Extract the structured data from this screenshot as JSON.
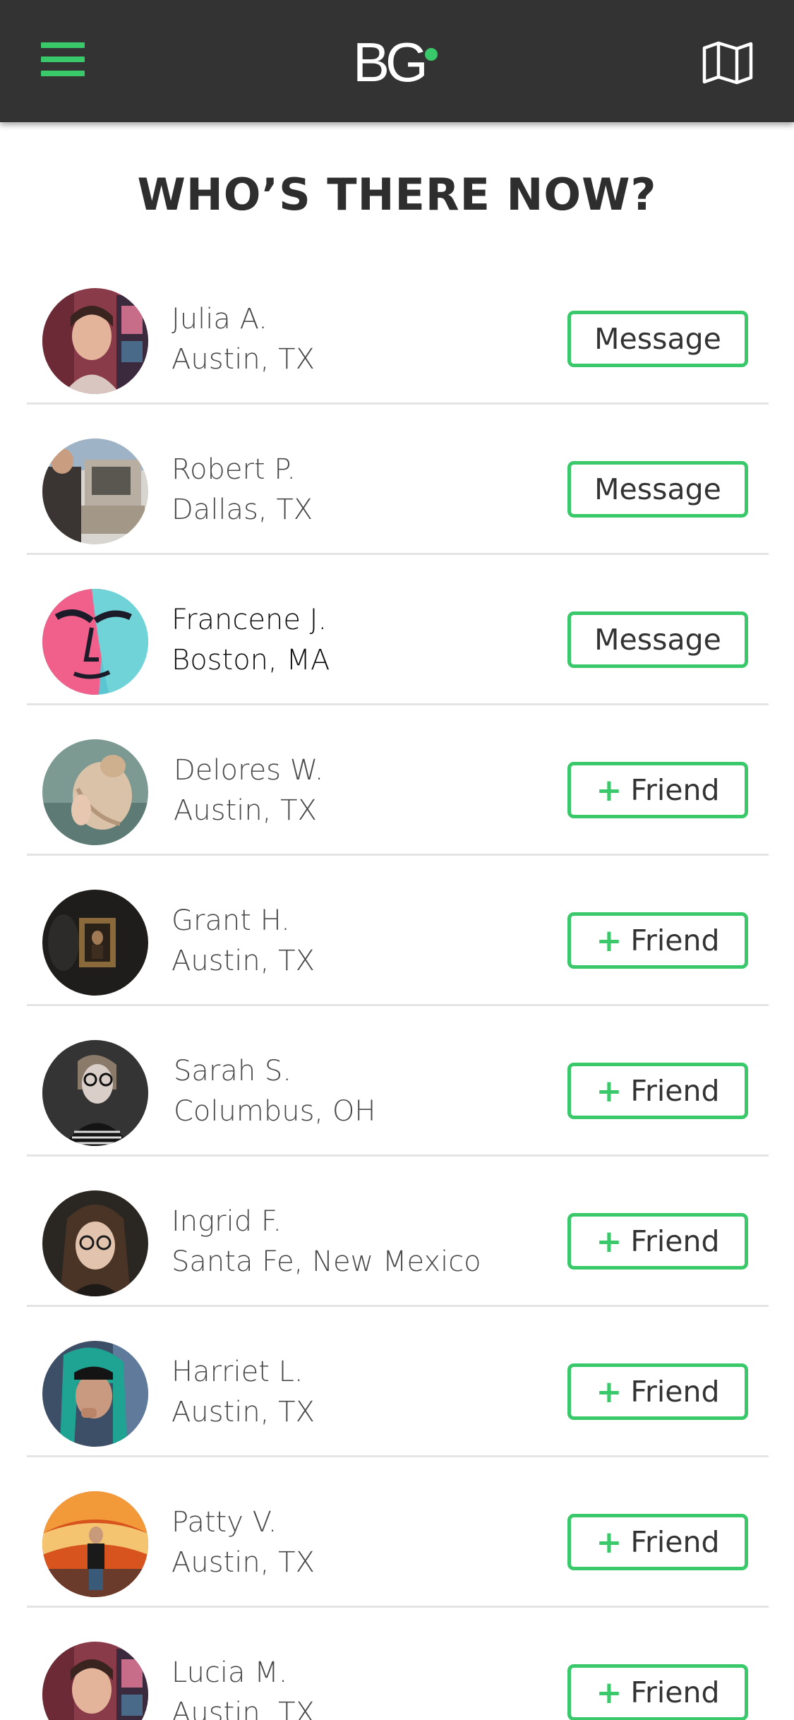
{
  "header": {
    "logo_text": "BG",
    "accent_color": "#3ac96a",
    "bar_color": "#333333",
    "menu_icon": "hamburger-menu-icon",
    "map_icon": "map-icon"
  },
  "page": {
    "title": "WHO’S THERE NOW?"
  },
  "people": [
    {
      "name": "Julia A.",
      "location": "Austin, TX",
      "action": "Message",
      "plus": "",
      "avatar": "photo-portrait-pink-room"
    },
    {
      "name": "Robert P.",
      "location": "Dallas, TX",
      "action": "Message",
      "plus": "",
      "avatar": "photo-retro-computer"
    },
    {
      "name": "Francene J.",
      "location": "Boston, MA",
      "action": "Message",
      "plus": "",
      "avatar": "photo-painted-face"
    },
    {
      "name": "Delores W.",
      "location": "Austin, TX",
      "action": "Friend",
      "plus": "+",
      "avatar": "photo-blonde-hair-back"
    },
    {
      "name": "Grant H.",
      "location": "Austin, TX",
      "action": "Friend",
      "plus": "+",
      "avatar": "photo-dark-framed-portrait"
    },
    {
      "name": "Sarah S.",
      "location": "Columbus, OH",
      "action": "Friend",
      "plus": "+",
      "avatar": "photo-woman-glasses-bw"
    },
    {
      "name": "Ingrid F.",
      "location": "Santa Fe, New Mexico",
      "action": "Friend",
      "plus": "+",
      "avatar": "photo-woman-glasses-long-hair"
    },
    {
      "name": "Harriet L.",
      "location": "Austin, TX",
      "action": "Friend",
      "plus": "+",
      "avatar": "photo-teal-hair-smoking"
    },
    {
      "name": "Patty V.",
      "location": "Austin, TX",
      "action": "Friend",
      "plus": "+",
      "avatar": "photo-orange-carnival"
    },
    {
      "name": "Lucia M.",
      "location": "Austin, TX",
      "action": "Friend",
      "plus": "+",
      "avatar": "photo-portrait-pink-room"
    }
  ]
}
